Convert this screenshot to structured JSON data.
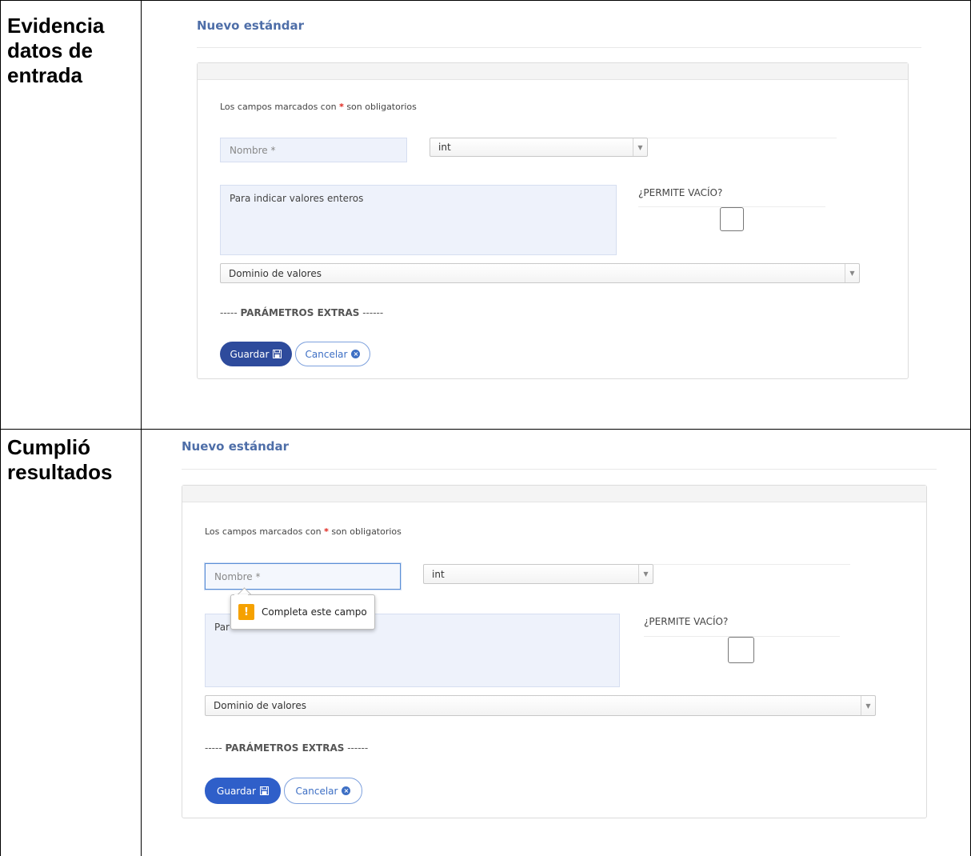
{
  "rows": [
    {
      "label": "Evidencia datos de entrada"
    },
    {
      "label": "Cumplió resultados"
    }
  ],
  "forms": [
    {
      "title": "Nuevo estándar",
      "required_note_prefix": "Los campos marcados con",
      "required_star": "*",
      "required_note_suffix": "son obligatorios",
      "name_placeholder": "Nombre *",
      "name_value": "",
      "type_select": "int",
      "description": "Para indicar valores enteros",
      "permite_vacio_label": "¿PERMITE VACÍO?",
      "permite_vacio_checked": false,
      "domain_select": "Dominio de valores",
      "extras_prefix": "-----",
      "extras_label": "PARÁMETROS EXTRAS",
      "extras_suffix": "------",
      "save_label": "Guardar",
      "cancel_label": "Cancelar"
    },
    {
      "title": "Nuevo estándar",
      "required_note_prefix": "Los campos marcados con",
      "required_star": "*",
      "required_note_suffix": "son obligatorios",
      "name_placeholder": "Nombre *",
      "name_value": "",
      "type_select": "int",
      "description": "Par",
      "permite_vacio_label": "¿PERMITE VACÍO?",
      "permite_vacio_checked": false,
      "domain_select": "Dominio de valores",
      "extras_prefix": "-----",
      "extras_label": "PARÁMETROS EXTRAS",
      "extras_suffix": "------",
      "save_label": "Guardar",
      "cancel_label": "Cancelar",
      "validation_message": "Completa este campo"
    }
  ],
  "colors": {
    "title": "#4e6ea8",
    "primary_button": "#2e4b9c",
    "primary_button_focused": "#2f5fc9",
    "outline_button": "#3d6fc4",
    "input_bg": "#eef2fb",
    "warning_icon": "#f5a100",
    "required_star": "#e0241b"
  },
  "icons": {
    "save": "floppy-disk-icon",
    "cancel": "times-circle-icon",
    "select_arrow": "caret-down-icon",
    "warning": "exclamation-icon"
  }
}
